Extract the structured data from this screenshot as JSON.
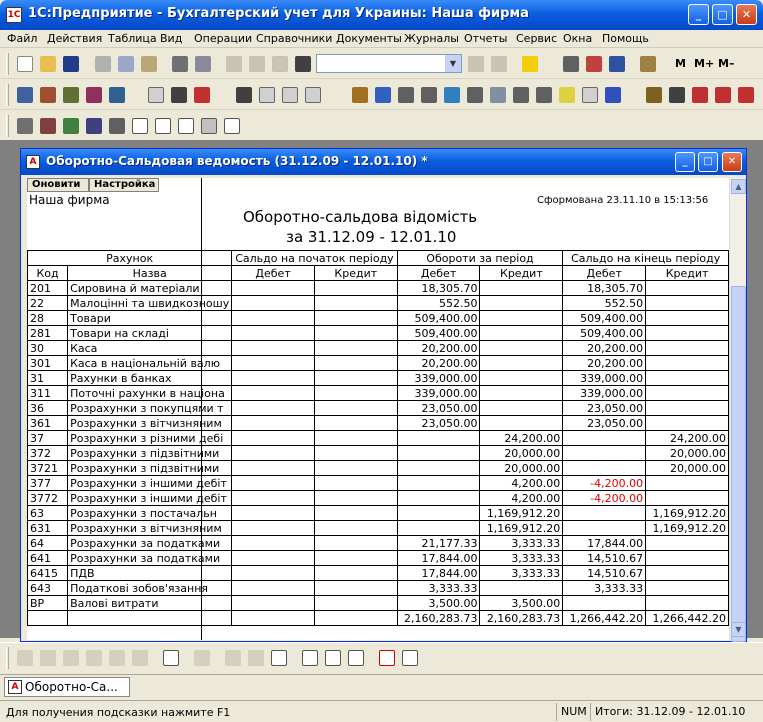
{
  "window": {
    "title": "1С:Предприятие - Бухгалтерский учет для Украины: Наша фирма"
  },
  "menu": [
    "Файл",
    "Действия",
    "Таблица",
    "Вид",
    "Операции",
    "Справочники",
    "Документы",
    "Журналы",
    "Отчеты",
    "Сервис",
    "Окна",
    "Помощь"
  ],
  "toolbar": {
    "m_label": "M",
    "mplus_label": "M+",
    "mminus_label": "M–"
  },
  "child": {
    "title": "Оборотно-Сальдовая ведомость (31.12.09 - 12.01.10)  *"
  },
  "report": {
    "refresh_button": "Оновити",
    "settings_button": "Настройка",
    "company": "Наша фирма",
    "generated": "Сформована 23.11.10 в 15:13:56",
    "title": "Оборотно-сальдова відомість",
    "period": "за 31.12.09 - 12.01.10",
    "headers": {
      "account": "Рахунок",
      "opening": "Сальдо на початок періоду",
      "turnover": "Обороти за період",
      "closing": "Сальдо на кінець періоду",
      "code": "Код",
      "name": "Назва",
      "debit": "Дебет",
      "credit": "Кредит"
    },
    "rows": [
      {
        "code": "201",
        "name": "Сировина й матеріали",
        "od": "",
        "oc": "",
        "td": "18,305.70",
        "tc": "",
        "cd": "18,305.70",
        "cc": ""
      },
      {
        "code": "22",
        "name": "Малоцінні та швидкозношу",
        "od": "",
        "oc": "",
        "td": "552.50",
        "tc": "",
        "cd": "552.50",
        "cc": ""
      },
      {
        "code": "28",
        "name": "Товари",
        "od": "",
        "oc": "",
        "td": "509,400.00",
        "tc": "",
        "cd": "509,400.00",
        "cc": ""
      },
      {
        "code": "281",
        "name": "Товари на складі",
        "od": "",
        "oc": "",
        "td": "509,400.00",
        "tc": "",
        "cd": "509,400.00",
        "cc": ""
      },
      {
        "code": "30",
        "name": "Каса",
        "od": "",
        "oc": "",
        "td": "20,200.00",
        "tc": "",
        "cd": "20,200.00",
        "cc": ""
      },
      {
        "code": "301",
        "name": "Каса в національній валю",
        "od": "",
        "oc": "",
        "td": "20,200.00",
        "tc": "",
        "cd": "20,200.00",
        "cc": ""
      },
      {
        "code": "31",
        "name": "Рахунки в банках",
        "od": "",
        "oc": "",
        "td": "339,000.00",
        "tc": "",
        "cd": "339,000.00",
        "cc": ""
      },
      {
        "code": "311",
        "name": "Поточні рахунки в націона",
        "od": "",
        "oc": "",
        "td": "339,000.00",
        "tc": "",
        "cd": "339,000.00",
        "cc": ""
      },
      {
        "code": "36",
        "name": "Розрахунки з покупцями т",
        "od": "",
        "oc": "",
        "td": "23,050.00",
        "tc": "",
        "cd": "23,050.00",
        "cc": ""
      },
      {
        "code": "361",
        "name": "Розрахунки з вітчизняним",
        "od": "",
        "oc": "",
        "td": "23,050.00",
        "tc": "",
        "cd": "23,050.00",
        "cc": ""
      },
      {
        "code": "37",
        "name": "Розрахунки з різними дебі",
        "od": "",
        "oc": "",
        "td": "",
        "tc": "24,200.00",
        "cd": "",
        "cc": "24,200.00"
      },
      {
        "code": "372",
        "name": "Розрахунки з підзвітними",
        "od": "",
        "oc": "",
        "td": "",
        "tc": "20,000.00",
        "cd": "",
        "cc": "20,000.00"
      },
      {
        "code": "3721",
        "name": "Розрахунки з підзвітними",
        "od": "",
        "oc": "",
        "td": "",
        "tc": "20,000.00",
        "cd": "",
        "cc": "20,000.00"
      },
      {
        "code": "377",
        "name": "Розрахунки з іншими дебіт",
        "od": "",
        "oc": "",
        "td": "",
        "tc": "4,200.00",
        "cd": "-4,200.00",
        "cc": "",
        "neg": true
      },
      {
        "code": "3772",
        "name": "Розрахунки з іншими дебіт",
        "od": "",
        "oc": "",
        "td": "",
        "tc": "4,200.00",
        "cd": "-4,200.00",
        "cc": "",
        "neg": true
      },
      {
        "code": "63",
        "name": "Розрахунки з постачальн",
        "od": "",
        "oc": "",
        "td": "",
        "tc": "1,169,912.20",
        "cd": "",
        "cc": "1,169,912.20"
      },
      {
        "code": "631",
        "name": "Розрахунки з вітчизняним",
        "od": "",
        "oc": "",
        "td": "",
        "tc": "1,169,912.20",
        "cd": "",
        "cc": "1,169,912.20"
      },
      {
        "code": "64",
        "name": "Розрахунки за податками",
        "od": "",
        "oc": "",
        "td": "21,177.33",
        "tc": "3,333.33",
        "cd": "17,844.00",
        "cc": ""
      },
      {
        "code": "641",
        "name": "Розрахунки за податками",
        "od": "",
        "oc": "",
        "td": "17,844.00",
        "tc": "3,333.33",
        "cd": "14,510.67",
        "cc": ""
      },
      {
        "code": "6415",
        "name": "ПДВ",
        "od": "",
        "oc": "",
        "td": "17,844.00",
        "tc": "3,333.33",
        "cd": "14,510.67",
        "cc": ""
      },
      {
        "code": "643",
        "name": "Податкові зобов'язання",
        "od": "",
        "oc": "",
        "td": "3,333.33",
        "tc": "",
        "cd": "3,333.33",
        "cc": ""
      },
      {
        "code": "ВР",
        "name": "Валові витрати",
        "od": "",
        "oc": "",
        "td": "3,500.00",
        "tc": "3,500.00",
        "cd": "",
        "cc": ""
      }
    ],
    "totals": {
      "td": "2,160,283.73",
      "tc": "2,160,283.73",
      "cd": "1,266,442.20",
      "cc": "1,266,442.20"
    }
  },
  "taskbar": {
    "task_label": "Оборотно-Са..."
  },
  "status": {
    "hint": "Для получения подсказки нажмите F1",
    "num": "NUM",
    "totals": "Итоги: 31.12.09 - 12.01.10"
  }
}
